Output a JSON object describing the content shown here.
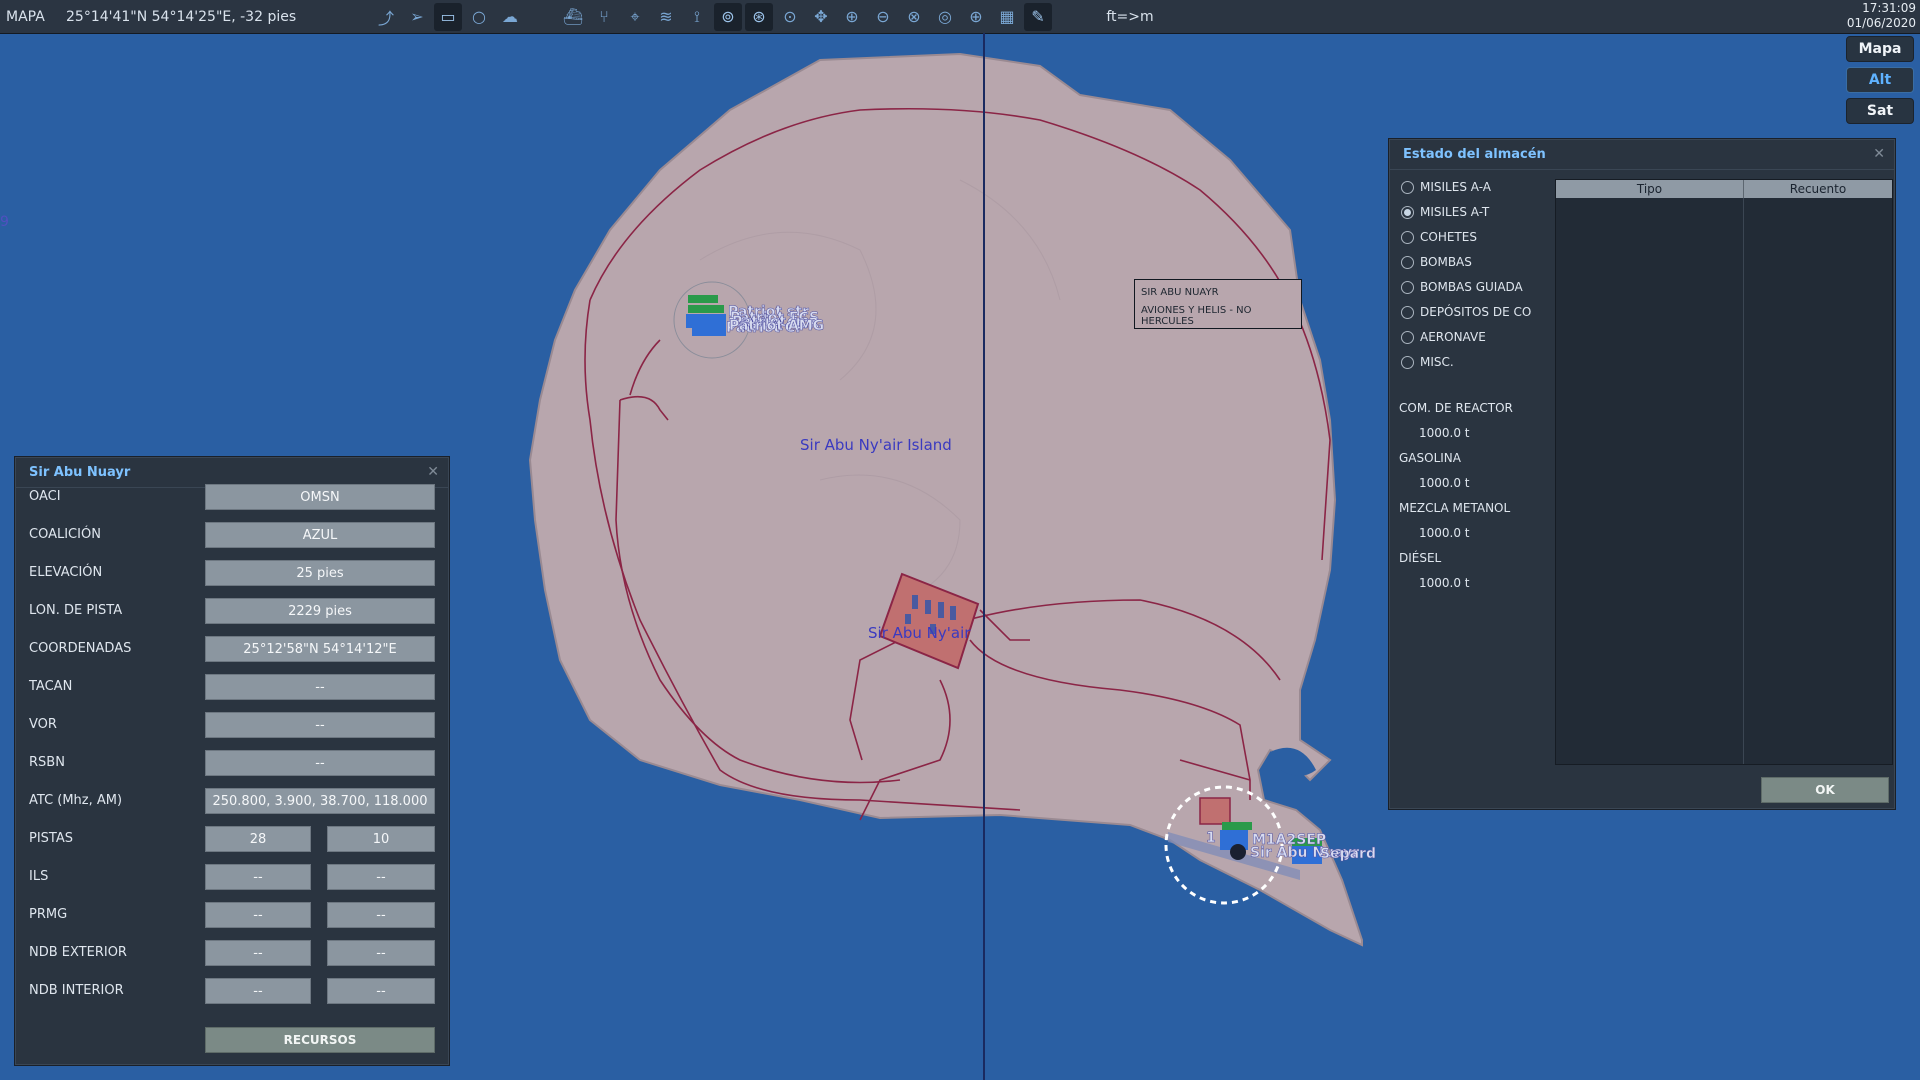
{
  "topbar": {
    "mode": "MAPA",
    "coords": "25°14'41\"N 54°14'25\"E, -32 pies",
    "unit_toggle": "ft=>m",
    "time": "17:31:09",
    "date": "01/06/2020",
    "icons": [
      "route-icon",
      "send-icon",
      "toggle-icon",
      "circle-icon",
      "clouds-icon",
      "ship-icon",
      "network-icon",
      "target-icon",
      "wifi-icon",
      "tower-icon",
      "zoom-area-a-icon",
      "zoom-area-b-icon",
      "zoom-area-c-icon",
      "pan-icon",
      "zoom-in-icon",
      "zoom-out-icon",
      "zoom-fit-icon",
      "radar-icon",
      "globe-icon",
      "grid-icon",
      "pencil-icon"
    ]
  },
  "map_layers": [
    "Mapa",
    "Alt",
    "Sat"
  ],
  "map": {
    "island_label": "Sir Abu Ny'air Island",
    "airbase_label": "Sir Abu Ny'air",
    "units_nw": [
      "Patriot str",
      "Patriot ECS",
      "Patriot GCR",
      "Patriot CP",
      "Patriot ln",
      "Patriot AMG"
    ],
    "units_se": [
      "M1A2SEP",
      "Sir Abu Nuayr",
      "Separd",
      "1"
    ],
    "colors": {
      "sea": "#2a5fa3",
      "land": "#b8a6ad",
      "roads": "#8b2546",
      "cursor_line": "#1a2a60"
    }
  },
  "info_box": {
    "line1": "SIR ABU NUAYR",
    "line2": "AVIONES Y HELIS - NO HERCULES"
  },
  "airbase_panel": {
    "title": "Sir Abu Nuayr",
    "rows": [
      {
        "label": "OACI",
        "value": "OMSN"
      },
      {
        "label": "COALICIÓN",
        "value": "AZUL"
      },
      {
        "label": "ELEVACIÓN",
        "value": "25 pies"
      },
      {
        "label": "LON. DE PISTA",
        "value": "2229 pies"
      },
      {
        "label": "COORDENADAS",
        "value": "25°12'58\"N 54°14'12\"E"
      },
      {
        "label": "TACAN",
        "value": "--"
      },
      {
        "label": "VOR",
        "value": "--"
      },
      {
        "label": "RSBN",
        "value": "--"
      },
      {
        "label": "ATC  (Mhz, AM)",
        "value": "250.800, 3.900, 38.700, 118.000"
      }
    ],
    "pair_rows": [
      {
        "label": "PISTAS",
        "v1": "28",
        "v2": "10"
      },
      {
        "label": "ILS",
        "v1": "--",
        "v2": "--"
      },
      {
        "label": "PRMG",
        "v1": "--",
        "v2": "--"
      },
      {
        "label": "NDB EXTERIOR",
        "v1": "--",
        "v2": "--"
      },
      {
        "label": "NDB INTERIOR",
        "v1": "--",
        "v2": "--"
      }
    ],
    "resources_button": "RECURSOS"
  },
  "warehouse": {
    "title": "Estado del almacén",
    "categories": [
      "MISILES A-A",
      "MISILES A-T",
      "COHETES",
      "BOMBAS",
      "BOMBAS GUIADA",
      "DEPÓSITOS DE CO",
      "AERONAVE",
      "MISC."
    ],
    "selected": "MISILES A-T",
    "fuels": [
      {
        "label": "COM. DE REACTOR",
        "value": "1000.0 t"
      },
      {
        "label": "GASOLINA",
        "value": "1000.0 t"
      },
      {
        "label": "MEZCLA METANOL",
        "value": "1000.0 t"
      },
      {
        "label": "DIÉSEL",
        "value": "1000.0 t"
      }
    ],
    "columns": [
      "Tipo",
      "Recuento"
    ],
    "ok_button": "OK"
  }
}
